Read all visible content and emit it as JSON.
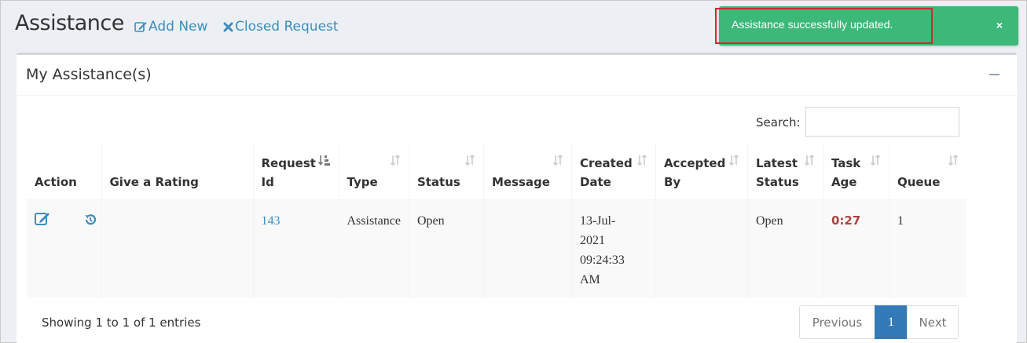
{
  "header": {
    "title": "Assistance",
    "add_new_label": "Add New",
    "closed_request_label": "Closed Request"
  },
  "toast": {
    "message": "Assistance successfully updated.",
    "close_label": "×",
    "color": "#3cb878"
  },
  "box": {
    "title": "My Assistance(s)"
  },
  "search": {
    "label": "Search:",
    "value": ""
  },
  "table": {
    "columns": [
      {
        "label_line1": "Action",
        "label_line2": ""
      },
      {
        "label_line1": "Give a Rating",
        "label_line2": ""
      },
      {
        "label_line1": "Request",
        "label_line2": "Id"
      },
      {
        "label_line1": "Type",
        "label_line2": ""
      },
      {
        "label_line1": "Status",
        "label_line2": ""
      },
      {
        "label_line1": "Message",
        "label_line2": ""
      },
      {
        "label_line1": "Created",
        "label_line2": "Date"
      },
      {
        "label_line1": "Accepted",
        "label_line2": "By"
      },
      {
        "label_line1": "Latest",
        "label_line2": "Status"
      },
      {
        "label_line1": "Task",
        "label_line2": "Age"
      },
      {
        "label_line1": "Queue",
        "label_line2": ""
      }
    ],
    "rows": [
      {
        "rating": "",
        "request_id": "143",
        "type": "Assistance",
        "status": "Open",
        "message": "",
        "created_l1": "13-Jul-",
        "created_l2": "2021",
        "created_l3": "09:24:33",
        "created_l4": "AM",
        "accepted_by": "",
        "latest_status": "Open",
        "task_age": "0:27",
        "queue": "1"
      }
    ]
  },
  "footer": {
    "info": "Showing 1 to 1 of 1 entries",
    "previous_label": "Previous",
    "current_page": "1",
    "next_label": "Next"
  },
  "colors": {
    "link": "#3c8dbc",
    "primary": "#337ab7",
    "danger_text": "#a94442",
    "highlight_border": "#d0282e"
  }
}
